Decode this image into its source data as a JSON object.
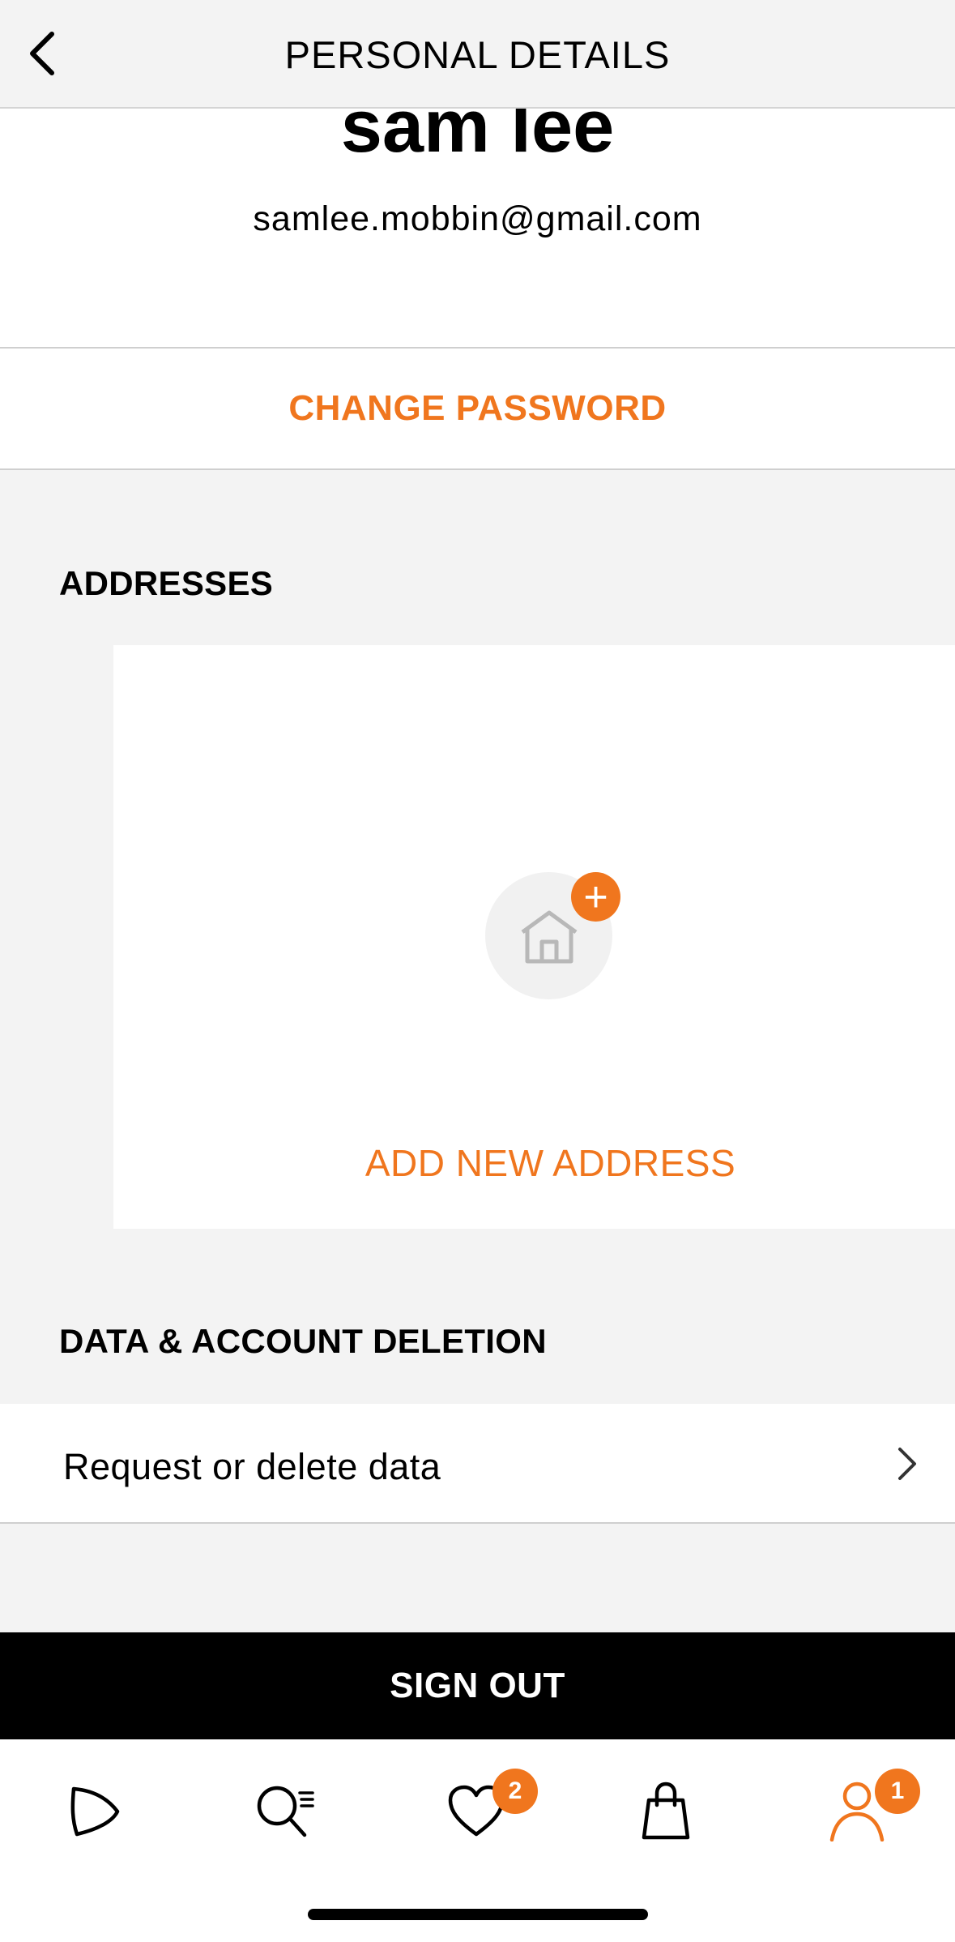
{
  "header": {
    "title": "PERSONAL DETAILS",
    "back_icon": "chevron-left-icon"
  },
  "profile": {
    "name": "sam lee",
    "email": "samlee.mobbin@gmail.com"
  },
  "change_password": {
    "label": "CHANGE PASSWORD"
  },
  "addresses": {
    "title": "ADDRESSES",
    "add_label": "ADD NEW ADDRESS",
    "add_icon": "house-add-icon"
  },
  "data_deletion": {
    "title": "DATA & ACCOUNT DELETION",
    "row_label": "Request or delete data"
  },
  "sign_out": {
    "label": "SIGN OUT"
  },
  "tabbar": {
    "tabs": [
      {
        "name": "home",
        "icon": "play-shape-icon"
      },
      {
        "name": "search",
        "icon": "search-icon"
      },
      {
        "name": "wishlist",
        "icon": "heart-icon",
        "badge": "2"
      },
      {
        "name": "bag",
        "icon": "bag-icon"
      },
      {
        "name": "account",
        "icon": "person-icon",
        "badge": "1",
        "active": true
      }
    ]
  },
  "colors": {
    "accent": "#f0761e",
    "background": "#f3f3f3",
    "dark": "#000000"
  }
}
